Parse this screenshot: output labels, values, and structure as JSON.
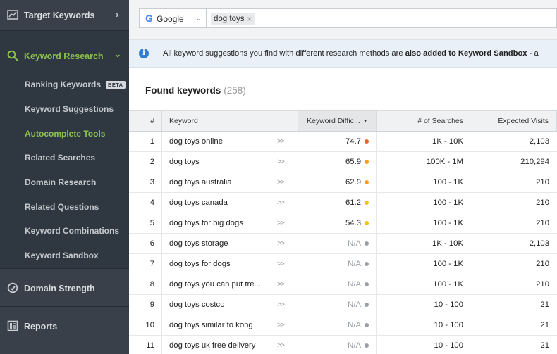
{
  "sidebar": {
    "target_keywords": {
      "label": "Target Keywords",
      "icon": "line-chart-icon"
    },
    "keyword_research": {
      "label": "Keyword Research",
      "icon": "search-icon"
    },
    "items": [
      {
        "label": "Ranking Keywords",
        "badge": "BETA"
      },
      {
        "label": "Keyword Suggestions"
      },
      {
        "label": "Autocomplete Tools",
        "active": true
      },
      {
        "label": "Related Searches"
      },
      {
        "label": "Domain Research"
      },
      {
        "label": "Related Questions"
      },
      {
        "label": "Keyword Combinations"
      },
      {
        "label": "Keyword Sandbox"
      }
    ],
    "domain_strength": {
      "label": "Domain Strength",
      "icon": "gauge-icon"
    },
    "reports": {
      "label": "Reports",
      "icon": "report-icon"
    }
  },
  "search": {
    "engine": "Google",
    "query_chip": "dog toys"
  },
  "info": {
    "text_pre": "All keyword suggestions you find with different research methods are ",
    "text_bold": "also added to Keyword Sandbox",
    "text_post": " - a"
  },
  "found": {
    "title": "Found keywords",
    "count": "(258)"
  },
  "table": {
    "headers": {
      "num": "#",
      "keyword": "Keyword",
      "difficulty": "Keyword Diffic...",
      "searches": "# of Searches",
      "visits": "Expected Visits"
    },
    "rows": [
      {
        "num": "1",
        "keyword": "dog toys online",
        "kd": "74.7",
        "kd_color": "#e8632b",
        "searches": "1K - 10K",
        "visits": "2,103"
      },
      {
        "num": "2",
        "keyword": "dog toys",
        "kd": "65.9",
        "kd_color": "#f4a21b",
        "searches": "100K - 1M",
        "visits": "210,294"
      },
      {
        "num": "3",
        "keyword": "dog toys australia",
        "kd": "62.9",
        "kd_color": "#f4a21b",
        "searches": "100 - 1K",
        "visits": "210"
      },
      {
        "num": "4",
        "keyword": "dog toys canada",
        "kd": "61.2",
        "kd_color": "#f4c21b",
        "searches": "100 - 1K",
        "visits": "210"
      },
      {
        "num": "5",
        "keyword": "dog toys for big dogs",
        "kd": "54.3",
        "kd_color": "#f4c21b",
        "searches": "100 - 1K",
        "visits": "210"
      },
      {
        "num": "6",
        "keyword": "dog toys storage",
        "kd": "N/A",
        "kd_color": "#9aa0a6",
        "searches": "1K - 10K",
        "visits": "2,103"
      },
      {
        "num": "7",
        "keyword": "dog toys for dogs",
        "kd": "N/A",
        "kd_color": "#9aa0a6",
        "searches": "100 - 1K",
        "visits": "210"
      },
      {
        "num": "8",
        "keyword": "dog toys you can put tre...",
        "kd": "N/A",
        "kd_color": "#9aa0a6",
        "searches": "100 - 1K",
        "visits": "210"
      },
      {
        "num": "9",
        "keyword": "dog toys costco",
        "kd": "N/A",
        "kd_color": "#9aa0a6",
        "searches": "10 - 100",
        "visits": "21"
      },
      {
        "num": "10",
        "keyword": "dog toys similar to kong",
        "kd": "N/A",
        "kd_color": "#9aa0a6",
        "searches": "10 - 100",
        "visits": "21"
      },
      {
        "num": "11",
        "keyword": "dog toys uk free delivery",
        "kd": "N/A",
        "kd_color": "#9aa0a6",
        "searches": "10 - 100",
        "visits": "21"
      }
    ]
  },
  "colors": {
    "accent_green": "#8cc152",
    "sidebar_bg": "#2f3740",
    "info_blue": "#2f80d1"
  }
}
